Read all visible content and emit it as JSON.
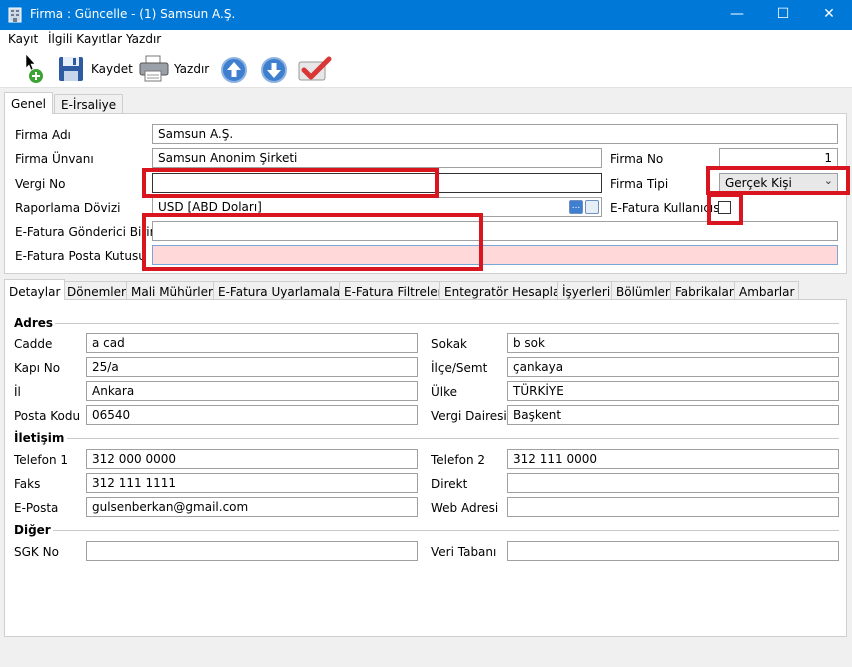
{
  "window": {
    "title": "Firma : Güncelle - (1) Samsun A.Ş.",
    "minimize_glyph": "—",
    "maximize_glyph": "☐",
    "close_glyph": "✕"
  },
  "menu": [
    "Kayıt",
    "İlgili Kayıtlar",
    "Yazdır"
  ],
  "toolbar": {
    "save_label": "Kaydet",
    "print_label": "Yazdır"
  },
  "top_tabs": [
    "Genel",
    "E-İrsaliye"
  ],
  "general": {
    "firma_adi": {
      "label": "Firma Adı",
      "value": "Samsun A.Ş."
    },
    "firma_unvani": {
      "label": "Firma Ünvanı",
      "value": "Samsun Anonim Şirketi"
    },
    "firma_no": {
      "label": "Firma No",
      "value": "1"
    },
    "vergi_no": {
      "label": "Vergi No",
      "value": ""
    },
    "firma_tipi": {
      "label": "Firma Tipi",
      "value": "Gerçek Kişi"
    },
    "raporlama_dovizi": {
      "label": "Raporlama Dövizi",
      "value": "USD [ABD Doları]",
      "ellipsis": "..."
    },
    "efatura_kullanicisi": {
      "label": "E-Fatura Kullanıcısı",
      "checked": false
    },
    "efatura_gonderici_birim": {
      "label": "E-Fatura Gönderici Birim",
      "value": ""
    },
    "efatura_posta_kutusu": {
      "label": "E-Fatura Posta Kutusu",
      "value": ""
    }
  },
  "detail_tabs": [
    "Detaylar",
    "Dönemler",
    "Mali Mühürler",
    "E-Fatura Uyarlamaları",
    "E-Fatura Filtreleri",
    "Entegratör Hesapları",
    "İşyerleri",
    "Bölümler",
    "Fabrikalar",
    "Ambarlar"
  ],
  "sections": {
    "adres": "Adres",
    "iletisim": "İletişim",
    "diger": "Diğer"
  },
  "adres": {
    "cadde": {
      "label": "Cadde",
      "value": "a cad"
    },
    "sokak": {
      "label": "Sokak",
      "value": "b sok"
    },
    "kapi_no": {
      "label": "Kapı No",
      "value": "25/a"
    },
    "ilce": {
      "label": "İlçe/Semt",
      "value": "çankaya"
    },
    "il": {
      "label": "İl",
      "value": "Ankara"
    },
    "ulke": {
      "label": "Ülke",
      "value": "TÜRKİYE"
    },
    "posta_kodu": {
      "label": "Posta Kodu",
      "value": "06540"
    },
    "vergi_dairesi": {
      "label": "Vergi Dairesi",
      "value": "Başkent"
    }
  },
  "iletisim": {
    "telefon1": {
      "label": "Telefon 1",
      "value": "312 000 0000"
    },
    "telefon2": {
      "label": "Telefon 2",
      "value": "312 111 0000"
    },
    "faks": {
      "label": "Faks",
      "value": "312 111 1111"
    },
    "direkt": {
      "label": "Direkt",
      "value": ""
    },
    "eposta": {
      "label": "E-Posta",
      "value": "gulsenberkan@gmail.com"
    },
    "web": {
      "label": "Web Adresi",
      "value": ""
    }
  },
  "diger": {
    "sgk": {
      "label": "SGK No",
      "value": ""
    },
    "veri_tabani": {
      "label": "Veri Tabanı",
      "value": ""
    }
  },
  "colors": {
    "titlebar": "#0078d7",
    "highlight": "#d9161f",
    "pink_field": "#ffd9d9"
  }
}
